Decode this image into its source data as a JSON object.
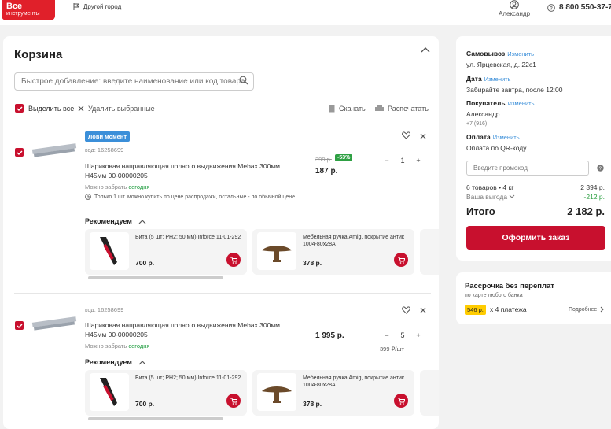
{
  "header": {
    "logo_line1": "Все",
    "logo_line2": "инструменты",
    "city": "Другой город",
    "user": "Александр",
    "phone": "8 800 550-37-7"
  },
  "cart": {
    "title": "Корзина",
    "quickadd_placeholder": "Быстрое добавление: введите наименование или код товара",
    "select_all": "Выделить все",
    "delete_selected": "Удалить выбранные",
    "download": "Скачать",
    "print": "Распечатать",
    "items": [
      {
        "badge": "Лови момент",
        "code": "код: 16258699",
        "name": "Шариковая направляющая полного выдвижения Mebax 300мм H45мм 00-00000205",
        "avail_prefix": "Можно забрать",
        "avail_day": "сегодня",
        "note": "Только 1 шт. можно купить по цене распродажи, остальные - по обычной цене",
        "old_price": "399 р.",
        "discount": "-53%",
        "price": "187 р.",
        "qty": "1",
        "minus": "−",
        "plus": "+"
      },
      {
        "code": "код: 16258699",
        "name": "Шариковая направляющая полного выдвижения Mebax 300мм H45мм 00-00000205",
        "avail_prefix": "Можно забрать",
        "avail_day": "сегодня",
        "price": "1 995 р.",
        "unit_price": "399 ₽/шт",
        "qty": "5",
        "minus": "−",
        "plus": "+"
      }
    ],
    "recommend_title": "Рекомендуем",
    "recs": [
      {
        "name": "Бита (5 шт; PH2; 50 мм) Inforce 11-01-292",
        "price": "700 р."
      },
      {
        "name": "Мебельная ручка Amig, покрытие антик 1004-80x28A",
        "price": "378 р."
      }
    ]
  },
  "summary": {
    "pickup_h": "Самовывоз",
    "change": "Изменить",
    "pickup_addr": "ул. Ярцевская, д. 22с1",
    "date_h": "Дата",
    "date_v": "Забирайте завтра, после 12:00",
    "buyer_h": "Покупатель",
    "buyer_name": "Александр",
    "buyer_phone": "+7 (916)",
    "pay_h": "Оплата",
    "pay_v": "Оплата по QR-коду",
    "promo_placeholder": "Введите промокод",
    "goods_label": "6 товаров • 4 кг",
    "goods_sum": "2 394 р.",
    "benefit_label": "Ваша выгода",
    "benefit_sum": "-212 р.",
    "total_label": "Итого",
    "total_sum": "2 182 р.",
    "order_btn": "Оформить заказ"
  },
  "installment": {
    "title": "Рассрочка без переплат",
    "sub": "по карте любого банка",
    "amount": "546 р.",
    "times": "х 4 платежа",
    "more": "Подробнее"
  },
  "colors": {
    "brand_red": "#c8102e",
    "accent_blue": "#3b8fd9",
    "green": "#2ea043"
  }
}
